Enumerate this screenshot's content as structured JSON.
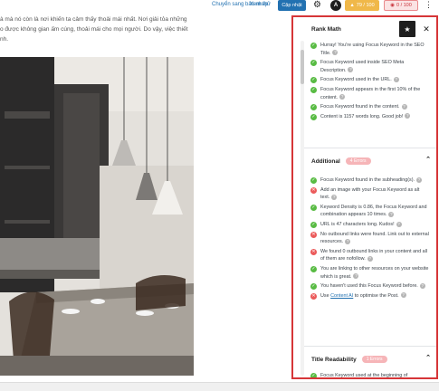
{
  "toolbar": {
    "switch_draft": "Chuyển sang bản nháp",
    "preview": "Xem thử",
    "update": "Cập nhật",
    "a_icon": "A",
    "seo_score": "79 / 100",
    "content_score": "0 / 100"
  },
  "article": {
    "lines": [
      "à mà nó còn là nơi khiến ta cảm thấy thoải mái nhất. Nơi giải tỏa những",
      "o được không gian ấm cúng, thoải mái cho mọi người. Do vậy, việc thiết",
      "nh."
    ]
  },
  "panel": {
    "title": "Rank Math",
    "pin_icon": "★",
    "close_icon": "✕",
    "basic": [
      {
        "status": "ok",
        "text": "Hurray! You're using Focus Keyword in the SEO Title."
      },
      {
        "status": "ok",
        "text": "Focus Keyword used inside SEO Meta Description."
      },
      {
        "status": "ok",
        "text": "Focus Keyword used in the URL."
      },
      {
        "status": "ok",
        "text": "Focus Keyword appears in the first 10% of the content."
      },
      {
        "status": "ok",
        "text": "Focus Keyword found in the content."
      },
      {
        "status": "ok",
        "text": "Content is 1157 words long. Good job!"
      }
    ],
    "additional": {
      "title": "Additional",
      "badge": "4 Errors",
      "items": [
        {
          "status": "ok",
          "text": "Focus Keyword found in the subheading(s)."
        },
        {
          "status": "bad",
          "text": "Add an image with your Focus Keyword as alt text."
        },
        {
          "status": "ok",
          "text": "Keyword Density is 0.86, the Focus Keyword and combination appears 10 times."
        },
        {
          "status": "ok",
          "text": "URL is 47 characters long. Kudos!"
        },
        {
          "status": "bad",
          "text": "No outbound links were found. Link out to external resources."
        },
        {
          "status": "bad",
          "text": "We found 0 outbound links in your content and all of them are nofollow."
        },
        {
          "status": "ok",
          "text": "You are linking to other resources on your website which is great."
        },
        {
          "status": "ok",
          "text": "You haven't used this Focus Keyword before."
        }
      ],
      "last": {
        "status": "bad",
        "pre": "Use ",
        "link": "Content AI",
        "post": " to optimise the Post."
      }
    },
    "title_readability": {
      "title": "Title Readability",
      "badge": "1 Errors",
      "partial_item": "Focus Keyword used at the beginning of"
    }
  },
  "colors": {
    "accent": "#2271b1",
    "ok": "#58bb43",
    "bad": "#eb5a5a",
    "panel_border": "#d63638"
  }
}
